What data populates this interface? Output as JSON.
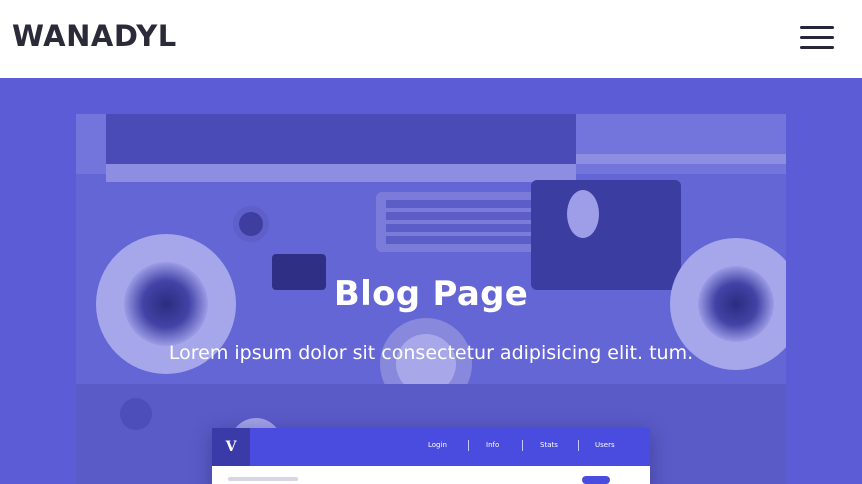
{
  "header": {
    "logo_text": "WANADYL",
    "menu_icon": "hamburger-menu-icon"
  },
  "hero": {
    "title": "Blog Page",
    "subtitle": "Lorem ipsum dolor sit consectetur adipisicing elit. tum.",
    "overlay_color": "#5b5cd6",
    "image_description_icon": "desk-workspace-photo"
  },
  "mockup": {
    "logo_letter": "V",
    "nav_items": [
      "Login",
      "Info",
      "Stats",
      "Users"
    ],
    "nav_color": "#4a4ce0"
  },
  "colors": {
    "header_bg": "#ffffff",
    "logo_color": "#2a2a38",
    "accent": "#5b5cd6"
  }
}
